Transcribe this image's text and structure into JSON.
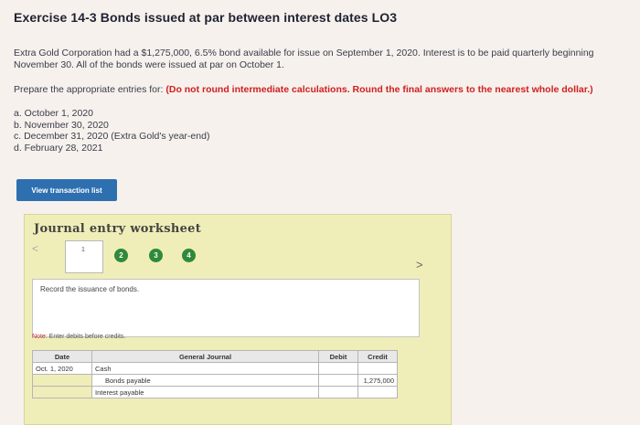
{
  "exercise": {
    "title": "Exercise 14-3 Bonds issued at par between interest dates LO3",
    "description": "Extra Gold Corporation had a $1,275,000, 6.5% bond available for issue on September 1, 2020. Interest is to be paid quarterly beginning November 30. All of the bonds were issued at par on October 1.",
    "prepare_text": "Prepare the appropriate entries for: ",
    "prepare_note": "(Do not round intermediate calculations. Round the final answers to the nearest whole dollar.)",
    "items": [
      "a. October 1, 2020",
      "b. November 30, 2020",
      "c. December 31, 2020 (Extra Gold's year-end)",
      "d. February 28, 2021"
    ]
  },
  "view_button_label": "View transaction list",
  "worksheet": {
    "title": "Journal entry worksheet",
    "nav_prev": "<",
    "nav_next": ">",
    "steps": [
      "1",
      "2",
      "3",
      "4"
    ],
    "instruction": "Record the issuance of bonds.",
    "note_label": "Note:",
    "note_text": " Enter debits before credits.",
    "table": {
      "headers": [
        "Date",
        "General Journal",
        "Debit",
        "Credit"
      ],
      "rows": [
        {
          "date": "Oct. 1, 2020",
          "account": "Cash",
          "debit": "",
          "credit": ""
        },
        {
          "date": "",
          "account": "Bonds payable",
          "debit": "",
          "credit": "1,275,000"
        },
        {
          "date": "",
          "account": "Interest payable",
          "debit": "",
          "credit": ""
        }
      ]
    }
  },
  "colors": {
    "button": "#2e6fb0",
    "step_active": "#2f8a3a",
    "note_red": "#d02020",
    "worksheet_bg": "#f0eeb8"
  }
}
